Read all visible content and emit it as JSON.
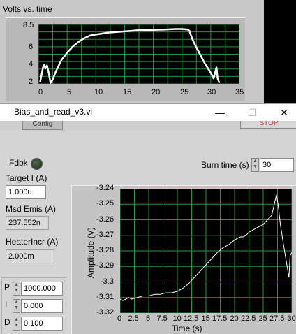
{
  "background_window": {
    "chart_title": "Volts vs. time",
    "y_ticks": [
      "8.5",
      "6",
      "4",
      "2"
    ],
    "x_ticks": [
      "0",
      "5",
      "10",
      "15",
      "20",
      "25",
      "30",
      "35"
    ]
  },
  "window": {
    "title": "Bias_and_read_v3.vi",
    "minimize": "—",
    "maximize": "☐",
    "close": "✕"
  },
  "toolbar": {
    "config_label": "Config",
    "stop_label": "STOP"
  },
  "panel": {
    "fdbk_label": "Fdbk",
    "target_label": "Target I (A)",
    "target_value": "1.000u",
    "msd_label": "Msd Emis (A)",
    "msd_value": "237.552n",
    "heater_label": "HeaterIncr (A)",
    "heater_value": "2.000m",
    "burn_label": "Burn time (s)",
    "burn_value": "30",
    "p_label": "P",
    "p_value": "1000.000",
    "i_label": "I",
    "i_value": "0.000",
    "d_label": "D",
    "d_value": "0.100"
  },
  "colors": {
    "plot_bg": "#000000",
    "grid": "#1e9a3c",
    "trace": "#ffffff",
    "panel_bg": "#d4d4d4"
  },
  "chart_data": [
    {
      "type": "line",
      "title": "Volts vs. time",
      "xlabel": "",
      "ylabel": "",
      "xlim": [
        0,
        35
      ],
      "ylim": [
        2,
        8.5
      ],
      "grid": true,
      "series": [
        {
          "x": [
            0.3,
            0.8,
            1.0,
            1.2,
            1.5,
            1.8,
            2.1,
            2.5,
            3,
            4,
            5,
            6,
            7,
            8,
            9,
            10,
            11,
            12,
            14,
            16,
            18,
            20,
            22,
            24,
            25,
            26,
            26.3,
            26.5,
            27,
            28,
            29,
            30,
            30.5,
            31,
            31.2,
            31.5
          ],
          "y": [
            2.2,
            3.8,
            4.1,
            3.7,
            4.0,
            3.2,
            2.1,
            2.5,
            3.3,
            4.6,
            5.4,
            6.1,
            6.6,
            7.0,
            7.3,
            7.4,
            7.5,
            7.6,
            7.7,
            7.8,
            7.9,
            7.9,
            7.95,
            8.0,
            8.0,
            7.95,
            7.8,
            7.4,
            6.6,
            5.4,
            4.2,
            3.2,
            2.6,
            3.8,
            2.6,
            2.1
          ]
        }
      ]
    },
    {
      "type": "line",
      "title": "",
      "xlabel": "Time (s)",
      "ylabel": "Amplitude (V)",
      "x_ticks": [
        "0",
        "2.5",
        "5",
        "7.5",
        "10",
        "12.5",
        "15",
        "17.5",
        "20",
        "22.5",
        "25",
        "27.5",
        "30"
      ],
      "y_ticks": [
        "-3.24",
        "-3.25",
        "-3.26",
        "-3.27",
        "-3.28",
        "-3.29",
        "-3.3",
        "-3.31",
        "-3.32"
      ],
      "xlim": [
        0,
        30
      ],
      "ylim": [
        -3.32,
        -3.24
      ],
      "grid": true,
      "series": [
        {
          "x": [
            0,
            0.5,
            1,
            1.5,
            2,
            3,
            4,
            5,
            6,
            7,
            8,
            9,
            10,
            11,
            12,
            13,
            14,
            15,
            16,
            17,
            18,
            19,
            20,
            20.5,
            21,
            21.5,
            22,
            22.5,
            23,
            24,
            25,
            26,
            26.5,
            27,
            27.3,
            27.6,
            28,
            28.5,
            29,
            29.3,
            29.5,
            29.7,
            30
          ],
          "y": [
            -3.311,
            -3.312,
            -3.311,
            -3.31,
            -3.311,
            -3.31,
            -3.309,
            -3.309,
            -3.308,
            -3.308,
            -3.307,
            -3.307,
            -3.306,
            -3.304,
            -3.301,
            -3.297,
            -3.293,
            -3.289,
            -3.285,
            -3.281,
            -3.278,
            -3.276,
            -3.273,
            -3.272,
            -3.271,
            -3.271,
            -3.27,
            -3.268,
            -3.267,
            -3.265,
            -3.263,
            -3.259,
            -3.257,
            -3.249,
            -3.244,
            -3.25,
            -3.263,
            -3.275,
            -3.286,
            -3.293,
            -3.297,
            -3.283,
            -3.281
          ]
        }
      ]
    }
  ]
}
